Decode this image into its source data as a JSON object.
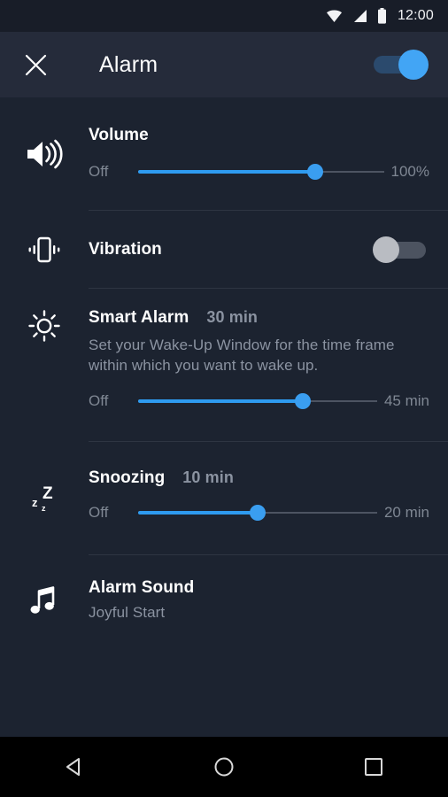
{
  "status_bar": {
    "clock": "12:00",
    "icons": [
      "wifi-icon",
      "cellular-signal-icon",
      "battery-icon"
    ]
  },
  "app_bar": {
    "close_icon": "close-icon",
    "title": "Alarm",
    "master_toggle": {
      "name": "alarm-master-toggle",
      "state": "on"
    }
  },
  "colors": {
    "accent": "#2E9BF0",
    "thumb": "#42A5F5",
    "background": "#1C2330",
    "app_bar": "#252B3A",
    "status_bar": "#181D28",
    "title_text": "#FFFFFF",
    "secondary_text": "#8B93A1",
    "divider": "#2E3542"
  },
  "sections": [
    {
      "id": "volume",
      "icon": "volume-up-icon",
      "title": "Volume",
      "value": "",
      "subtitle": "",
      "slider": {
        "min_label": "Off",
        "max_label": "100%",
        "percent": 72
      }
    },
    {
      "id": "vibration",
      "icon": "vibration-icon",
      "title": "Vibration",
      "toggle": {
        "name": "vibration-toggle",
        "state": "off"
      }
    },
    {
      "id": "smart-alarm",
      "icon": "brightness-sun-icon",
      "title": "Smart Alarm",
      "value": "30 min",
      "subtitle": "Set your Wake-Up Window for the time frame within which you want to wake up.",
      "slider": {
        "min_label": "Off",
        "max_label": "45 min",
        "percent": 69
      }
    },
    {
      "id": "snoozing",
      "icon": "snooze-zzz-icon",
      "title": "Snoozing",
      "value": "10 min",
      "subtitle": "",
      "slider": {
        "min_label": "Off",
        "max_label": "20 min",
        "percent": 50
      }
    },
    {
      "id": "alarm-sound",
      "icon": "music-note-icon",
      "title": "Alarm Sound",
      "value": "",
      "subtitle": "Joyful Start"
    }
  ],
  "nav_bar": {
    "back": "back-triangle-icon",
    "home": "home-circle-icon",
    "recents": "recents-square-icon"
  }
}
